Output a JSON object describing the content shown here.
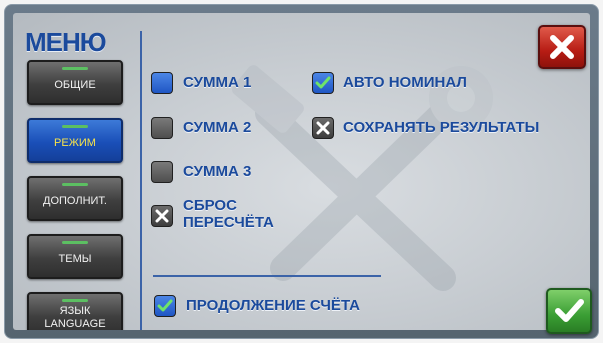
{
  "menu": {
    "title": "МЕНЮ"
  },
  "sidebar": {
    "items": [
      {
        "label": "ОБЩИЕ"
      },
      {
        "label": "РЕЖИМ",
        "active": true
      },
      {
        "label": "ДОПОЛНИТ."
      },
      {
        "label": "ТЕМЫ"
      },
      {
        "label_line1": "ЯЗЫК",
        "label_line2": "LANGUAGE"
      }
    ]
  },
  "options": {
    "summa1": {
      "label": "СУММА 1",
      "state": "selected"
    },
    "summa2": {
      "label": "СУММА 2",
      "state": "unchecked"
    },
    "summa3": {
      "label": "СУММА 3",
      "state": "unchecked"
    },
    "sbros": {
      "label_line1": "СБРОС",
      "label_line2": "ПЕРЕСЧЁТА",
      "state": "crossed"
    },
    "avto_nominal": {
      "label": "АВТО НОМИНАЛ",
      "state": "checked"
    },
    "sokhranyat": {
      "label": "СОХРАНЯТЬ РЕЗУЛЬТАТЫ",
      "state": "crossed"
    },
    "prodolzhenie": {
      "label": "ПРОДОЛЖЕНИЕ СЧЁТА",
      "state": "checked"
    }
  },
  "icons": {
    "close": "close-icon",
    "ok": "checkmark-icon",
    "watermark": "tools-wrench-hammer-icon"
  },
  "colors": {
    "label_blue": "#1b4a9c",
    "active_tab_text": "#f7e34a",
    "close_red": "#b71c14",
    "ok_green": "#3a9e34"
  }
}
